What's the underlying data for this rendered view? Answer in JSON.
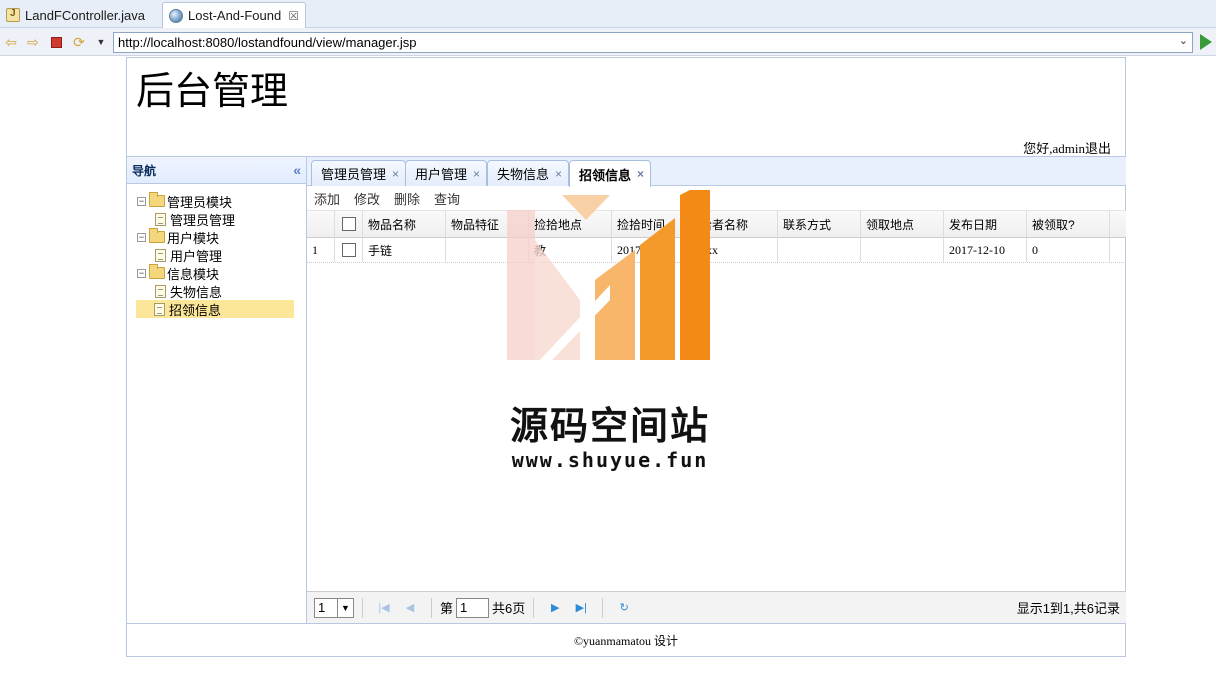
{
  "ide": {
    "tabs": [
      {
        "label": "LandFController.java"
      },
      {
        "label": "Lost-And-Found",
        "close": "☒"
      }
    ]
  },
  "browser": {
    "url": "http://localhost:8080/lostandfound/view/manager.jsp"
  },
  "page": {
    "title": "后台管理",
    "greeting": "您好,admin",
    "logout": "退出"
  },
  "nav": {
    "title": "导航",
    "collapse": "«",
    "tree": [
      {
        "label": "管理员模块",
        "children": [
          "管理员管理"
        ]
      },
      {
        "label": "用户模块",
        "children": [
          "用户管理"
        ]
      },
      {
        "label": "信息模块",
        "children": [
          "失物信息",
          "招领信息"
        ]
      }
    ]
  },
  "tabs": [
    {
      "label": "管理员管理"
    },
    {
      "label": "用户管理"
    },
    {
      "label": "失物信息"
    },
    {
      "label": "招领信息"
    }
  ],
  "toolbar": {
    "add": "添加",
    "edit": "修改",
    "delete": "删除",
    "query": "查询"
  },
  "grid": {
    "columns": [
      "物品名称",
      "物品特征",
      "捡拾地点",
      "捡拾时间",
      "拾者名称",
      "联系方式",
      "领取地点",
      "发布日期",
      "被领取?"
    ],
    "rows": [
      {
        "num": "1",
        "cells": [
          "手链",
          "",
          "教",
          "2017-12",
          "xxx",
          "",
          "",
          "2017-12-10",
          "0"
        ]
      }
    ]
  },
  "pager": {
    "page_size": "1",
    "page_prefix": "第",
    "page_value": "1",
    "page_suffix": "共6页",
    "info": "显示1到1,共6记录"
  },
  "footer": {
    "text": "©yuanmamatou 设计"
  },
  "watermark": {
    "title": "源码空间站",
    "url": "www.shuyue.fun"
  },
  "colors": {
    "accent": "#e8f0fd",
    "selected": "#fbe699",
    "watermark_orange": "#f39a2b"
  }
}
